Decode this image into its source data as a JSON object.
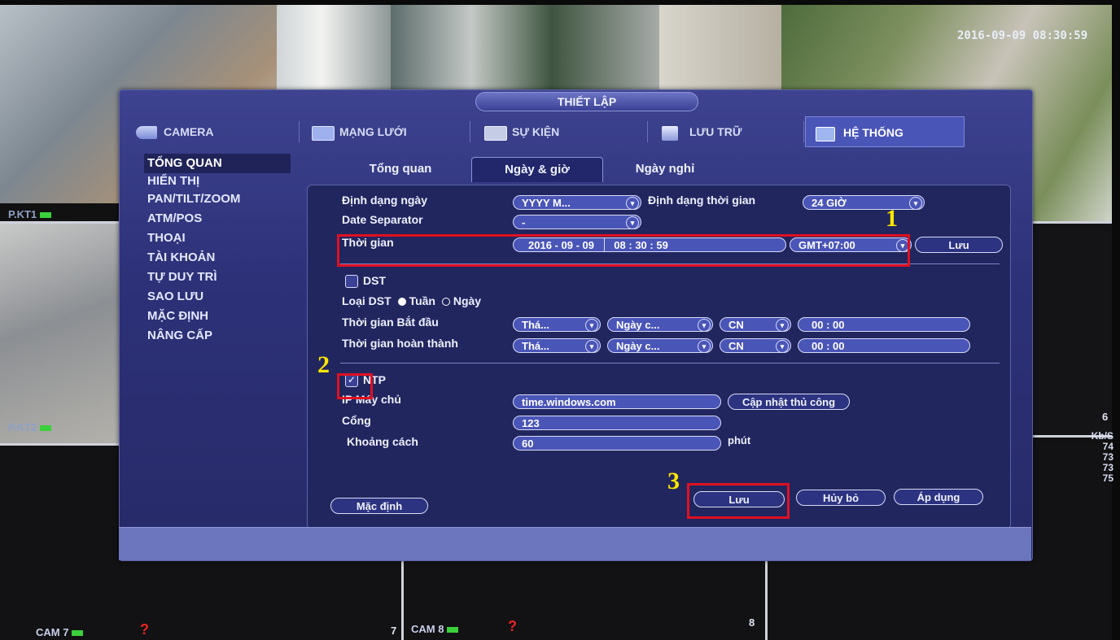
{
  "background": {
    "timestamp": "2016-09-09 08:30:59",
    "cameras": [
      {
        "label": "P.KT1"
      },
      {
        "label": "P.KT2"
      },
      {
        "label": "CAM 7"
      },
      {
        "label": "CAM 8"
      }
    ],
    "channel_numbers": [
      "7",
      "8",
      "6"
    ],
    "rate_unit": "Kb/S",
    "rates": [
      "74",
      "73",
      "73",
      "75"
    ]
  },
  "dialog": {
    "title": "THIẾT LẬP",
    "tabs": [
      {
        "label": "CAMERA",
        "icon": "camera-icon"
      },
      {
        "label": "MẠNG LƯỚI",
        "icon": "network-icon"
      },
      {
        "label": "SỰ KIỆN",
        "icon": "event-icon"
      },
      {
        "label": "LƯU TRỮ",
        "icon": "storage-icon"
      },
      {
        "label": "HỆ THỐNG",
        "icon": "system-icon",
        "active": true
      }
    ],
    "sidebar": [
      {
        "label": "TỔNG QUAN",
        "active": true
      },
      {
        "label": "HIỂN THỊ"
      },
      {
        "label": "PAN/TILT/ZOOM"
      },
      {
        "label": "ATM/POS"
      },
      {
        "label": "THOẠI"
      },
      {
        "label": "TÀI KHOẢN"
      },
      {
        "label": "TỰ DUY TRÌ"
      },
      {
        "label": "SAO LƯU"
      },
      {
        "label": "MẶC ĐỊNH"
      },
      {
        "label": "NÂNG CẤP"
      }
    ],
    "subtabs": [
      {
        "label": "Tổng quan"
      },
      {
        "label": "Ngày & giờ",
        "active": true
      },
      {
        "label": "Ngày nghỉ"
      }
    ],
    "form": {
      "date_format_label": "Định dạng ngày",
      "date_format_value": "YYYY M...",
      "time_format_label": "Định dạng thời gian",
      "time_format_value": "24 GIỜ",
      "date_separator_label": "Date Separator",
      "date_separator_value": "-",
      "time_label": "Thời gian",
      "date_year": "2016",
      "date_month": "09",
      "date_day": "09",
      "time_hour": "08",
      "time_minute": "30",
      "time_second": "59",
      "timezone": "GMT+07:00",
      "save_time_button": "Lưu",
      "dst_label": "DST",
      "dst_checked": false,
      "dst_type_label": "Loại DST",
      "dst_week": "Tuần",
      "dst_day": "Ngày",
      "start_time_label": "Thời gian Bắt đầu",
      "end_time_label": "Thời gian hoàn thành",
      "start": {
        "month": "Thá...",
        "week": "Ngày c...",
        "weekday": "CN",
        "hour": "00",
        "minute": "00"
      },
      "end": {
        "month": "Thá...",
        "week": "Ngày c...",
        "weekday": "CN",
        "hour": "00",
        "minute": "00"
      },
      "ntp_label": "NTP",
      "ntp_checked": true,
      "server_label": "IP Máy chủ",
      "server_value": "time.windows.com",
      "manual_update_button": "Cập nhật thủ công",
      "port_label": "Cổng",
      "port_value": "123",
      "interval_label": "Khoảng cách",
      "interval_value": "60",
      "interval_unit": "phút"
    },
    "buttons": {
      "default": "Mặc định",
      "save": "Lưu",
      "cancel": "Hủy bỏ",
      "apply": "Áp dụng"
    }
  },
  "annotations": {
    "step1": "1",
    "step2": "2",
    "step3": "3",
    "color": "#e01020",
    "number_color": "#ffe600"
  }
}
